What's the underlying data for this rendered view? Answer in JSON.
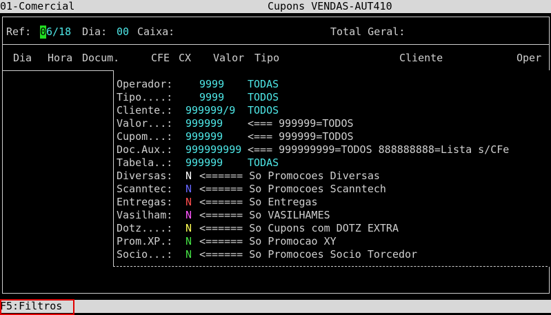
{
  "title_left": "01-Comercial",
  "title_center": "Cupons VENDAS-AUT410",
  "ref": {
    "label": "Ref:",
    "cursor_char": "0",
    "value_rest": "6/18",
    "dia_label": "Dia:",
    "dia_value": "00",
    "caixa_label": "Caixa:",
    "total_label": "Total Geral:"
  },
  "columns": [
    "Dia",
    "Hora",
    "Docum.",
    "CFE",
    "CX",
    "Valor",
    "Tipo",
    "Cliente",
    "Oper"
  ],
  "filters": [
    {
      "label": "Operador:",
      "value": "9999",
      "desc": "TODAS"
    },
    {
      "label": "Tipo....:",
      "value": "9999",
      "desc": "TODOS"
    },
    {
      "label": "Cliente.:",
      "value": "999999/9",
      "desc": "TODOS"
    },
    {
      "label": "Valor...:",
      "value": "999999",
      "desc": "<=== 999999=TODOS"
    },
    {
      "label": "Cupom...:",
      "value": "999999",
      "desc": "<=== 999999=TODOS"
    },
    {
      "label": "Doc.Aux.:",
      "value": "999999999",
      "desc": "<=== 999999999=TODOS 888888888=Lista s/CFe"
    },
    {
      "label": "Tabela..:",
      "value": "999999",
      "desc": "TODAS"
    }
  ],
  "flags": [
    {
      "label": "Diversas:",
      "value": "N",
      "color": "#ffffff",
      "desc": "<====== So Promocoes Diversas"
    },
    {
      "label": "Scanntec:",
      "value": "N",
      "color": "#6666ff",
      "desc": "<====== So Promocoes Scanntech"
    },
    {
      "label": "Entregas:",
      "value": "N",
      "color": "#ff4d4d",
      "desc": "<====== So Entregas"
    },
    {
      "label": "Vasilham:",
      "value": "N",
      "color": "#ff55ff",
      "desc": "<====== So VASILHAMES"
    },
    {
      "label": "Dotz....:",
      "value": "N",
      "color": "#ffff55",
      "desc": "<====== So Cupons com DOTZ EXTRA"
    },
    {
      "label": "Prom.XP.:",
      "value": "N",
      "color": "#44e044",
      "desc": "<====== So Promocao XY"
    },
    {
      "label": "Socio...:",
      "value": "N",
      "color": "#44e044",
      "desc": "<====== So Promocoes Socio Torcedor"
    }
  ],
  "status": {
    "f5": "F5:Filtros"
  },
  "accent_colors": {
    "cursor": "#22dd22",
    "value": "#4ee7e7",
    "highlight_box": "#e00000"
  }
}
